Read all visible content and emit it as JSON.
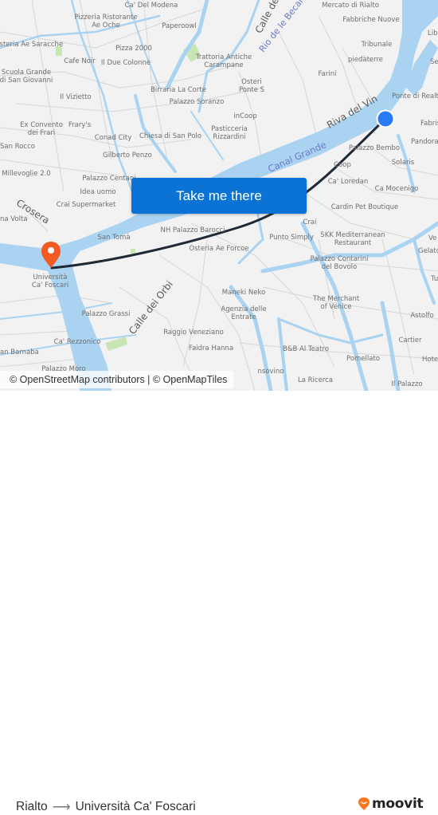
{
  "map": {
    "origin_label": "Rialto",
    "destination_label": "Università Ca' Foscari",
    "colors": {
      "land": "#f2f2f2",
      "water": "#aad3f2",
      "park": "#c8e6b4",
      "route": "#1f2a36",
      "origin_marker": "#2a7cf6",
      "destination_marker": "#f15a22",
      "button": "#0b73d6"
    },
    "place_labels": [
      "Ca' Del Modena",
      "Pizzeria Ristorante\nAe Oche",
      "Paperoowl",
      "Osteria Ae Saracche",
      "Pizza 2000",
      "Cafe Noir",
      "Il Due Colonne",
      "Trattoria Antiche\nCarampane",
      "Scuola Grande\ndi San Giovanni",
      "Birraria La Corte",
      "Palazzo Soranzo",
      "Il Vizietto",
      "Osteri\nPonte S",
      "Mercato di Rialto",
      "Fabbriche Nuove",
      "Tribunale",
      "piedàterre",
      "Farini",
      "Ponte di Realto",
      "Libr",
      "Sep",
      "Ex Convento\ndei Frari",
      "Frary's",
      "Conad City",
      "Chiesa di San Polo",
      "Pasticceria\nRizzardini",
      "inCoop",
      "San Rocco",
      "Gilberto Penzo",
      "Millevoglie 2.0",
      "Palazzo Centani",
      "Idea uomo",
      "Crai Supermarket",
      "Palazzo Bembo",
      "Fabris",
      "Pandora",
      "Solaris",
      "Coop",
      "Ca' Loredan",
      "Ca Mocenigo",
      "Cardin Pet Boutique",
      "na Volta",
      "San Tomà",
      "NH Palazzo Barocci",
      "Osteria Ae Forcoe",
      "Crai",
      "Punto Simply",
      "SKK Mediterranean\nRestaurant",
      "Ve",
      "Gelato",
      "Palazzo Contarini\ndel Bovolo",
      "Tu",
      "Palazzo Grassi",
      "Maneki Neko",
      "The Merchant\nof Venice",
      "Agenzia delle\nEntrate",
      "Astolfo",
      "Raggio Veneziano",
      "Ca' Rezzonico",
      "Faidra Hanna",
      "Cartier",
      "an Barnaba",
      "B&B Al Teatro",
      "Pomellato",
      "Hotel",
      "Palazzo Moro",
      "nsovino",
      "La Ricerca",
      "Il Palazzo",
      "Università\nCa' Foscari"
    ],
    "street_labels": [
      "Calle dei",
      "Crosera",
      "Calle dei Orbi"
    ],
    "water_labels": [
      "Rio de le Becarie",
      "Canal Grande",
      "Riva del Vin"
    ]
  },
  "cta": {
    "label": "Take me there"
  },
  "attribution": "© OpenStreetMap contributors | © OpenMapTiles",
  "footer": {
    "from": "Rialto",
    "arrow": "⟶",
    "to": "Università Ca' Foscari",
    "brand": "moovit"
  }
}
